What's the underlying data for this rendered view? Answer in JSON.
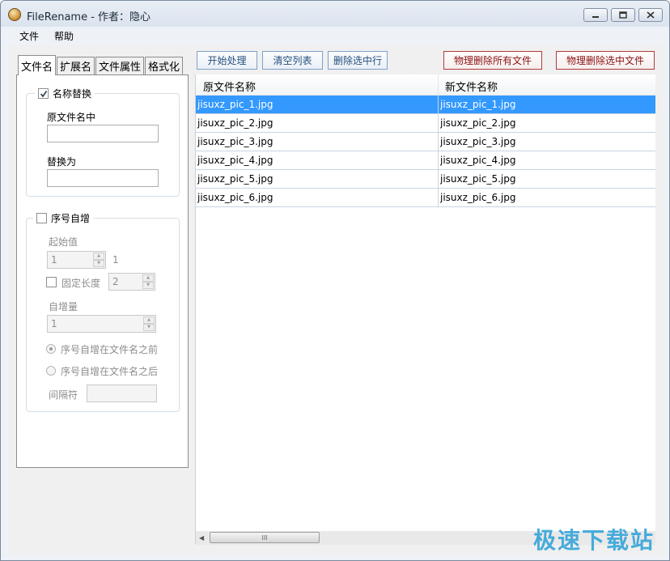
{
  "window": {
    "title": "FileRename - 作者：隐心"
  },
  "menu": [
    "文件",
    "帮助"
  ],
  "tabs": [
    "文件名",
    "扩展名",
    "文件属性",
    "格式化"
  ],
  "name_replace": {
    "checkbox_label": "名称替换",
    "checked": true,
    "find_label": "原文件名中",
    "find_value": "",
    "replace_label": "替换为",
    "replace_value": ""
  },
  "sequence": {
    "checkbox_label": "序号自增",
    "checked": false,
    "start_label": "起始值",
    "start_value": "1",
    "start_preview": "1",
    "fixed_length_label": "固定长度",
    "fixed_length_checked": false,
    "fixed_length_value": "2",
    "increment_label": "自增量",
    "increment_value": "1",
    "before_label": "序号自增在文件名之前",
    "before_selected": true,
    "after_label": "序号自增在文件名之后",
    "separator_label": "间隔符",
    "separator_value": ""
  },
  "toolbar": {
    "start": "开始处理",
    "clear": "清空列表",
    "delete_rows": "删除选中行",
    "delete_all_files": "物理删除所有文件",
    "delete_selected_files": "物理删除选中文件"
  },
  "list": {
    "columns": [
      "原文件名称",
      "新文件名称"
    ],
    "rows": [
      {
        "original": "jisuxz_pic_1.jpg",
        "new": "jisuxz_pic_1.jpg",
        "selected": true
      },
      {
        "original": "jisuxz_pic_2.jpg",
        "new": "jisuxz_pic_2.jpg",
        "selected": false
      },
      {
        "original": "jisuxz_pic_3.jpg",
        "new": "jisuxz_pic_3.jpg",
        "selected": false
      },
      {
        "original": "jisuxz_pic_4.jpg",
        "new": "jisuxz_pic_4.jpg",
        "selected": false
      },
      {
        "original": "jisuxz_pic_5.jpg",
        "new": "jisuxz_pic_5.jpg",
        "selected": false
      },
      {
        "original": "jisuxz_pic_6.jpg",
        "new": "jisuxz_pic_6.jpg",
        "selected": false
      }
    ]
  },
  "colors": {
    "selection": "#3399ff",
    "primary_button_text": "#25507e",
    "danger_button_text": "#8b1010"
  },
  "watermark": "极速下载站"
}
